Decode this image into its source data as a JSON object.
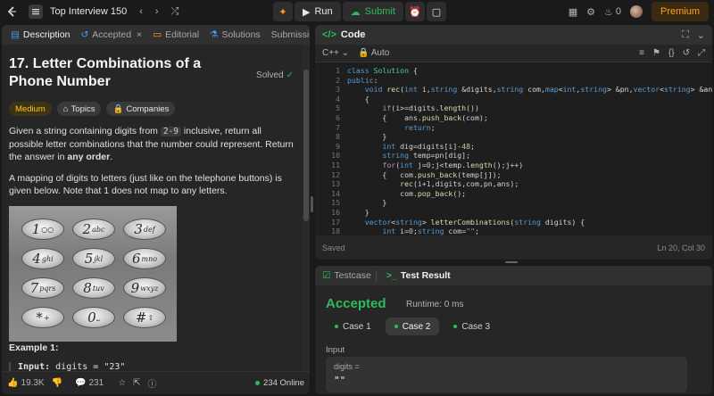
{
  "topbar": {
    "title": "Top Interview 150",
    "run_label": "Run",
    "submit_label": "Submit",
    "streak": "0",
    "premium_label": "Premium"
  },
  "left_tabs": [
    {
      "label": "Description"
    },
    {
      "label": "Accepted"
    },
    {
      "label": "Editorial"
    },
    {
      "label": "Solutions"
    },
    {
      "label": "Submissio"
    }
  ],
  "problem": {
    "title": "17. Letter Combinations of a Phone Number",
    "status": "Solved",
    "difficulty": "Medium",
    "topics_label": "Topics",
    "companies_label": "Companies",
    "desc_p1_a": "Given a string containing digits from ",
    "desc_p1_code": "2-9",
    "desc_p1_b": " inclusive, return all possible letter combinations that the number could represent. Return the answer in ",
    "desc_p1_bold": "any order",
    "desc_p1_end": ".",
    "desc_p2": "A mapping of digits to letters (just like on the telephone buttons) is given below. Note that 1 does not map to any letters.",
    "example_title": "Example 1:",
    "example_input_label": "Input:",
    "example_input_value": "digits = \"23\""
  },
  "phone_keys": [
    {
      "digit": "1",
      "letters": "○○"
    },
    {
      "digit": "2",
      "letters": "abc"
    },
    {
      "digit": "3",
      "letters": "def"
    },
    {
      "digit": "4",
      "letters": "ghi"
    },
    {
      "digit": "5",
      "letters": "jkl"
    },
    {
      "digit": "6",
      "letters": "mno"
    },
    {
      "digit": "7",
      "letters": "pqrs"
    },
    {
      "digit": "8",
      "letters": "tuv"
    },
    {
      "digit": "9",
      "letters": "wxyz"
    },
    {
      "digit": "*",
      "letters": "+"
    },
    {
      "digit": "0",
      "letters": "⎵"
    },
    {
      "digit": "#",
      "letters": "⇧"
    }
  ],
  "footer": {
    "likes": "19.3K",
    "comments": "231",
    "online": "234 Online"
  },
  "code_panel": {
    "title": "Code",
    "language": "C++",
    "mode": "Auto",
    "status": "Saved",
    "cursor": "Ln 20, Col 30"
  },
  "code_lines": [
    "class Solution {",
    "public:",
    "    void rec(int i,string &digits,string com,map<int,string> &pn,vector<string> &ans)",
    "    {",
    "        if(i>=digits.length())",
    "        {    ans.push_back(com);",
    "             return;",
    "        }",
    "        int dig=digits[i]-48;",
    "        string temp=pn[dig];",
    "        for(int j=0;j<temp.length();j++)",
    "        {   com.push_back(temp[j]);",
    "            rec(i+1,digits,com,pn,ans);",
    "            com.pop_back();",
    "        }",
    "    }",
    "    vector<string> letterCombinations(string digits) {",
    "        int i=0;string com=\"\";"
  ],
  "result": {
    "testcase_tab": "Testcase",
    "result_tab": "Test Result",
    "verdict": "Accepted",
    "runtime": "Runtime: 0 ms",
    "cases": [
      {
        "label": "Case 1"
      },
      {
        "label": "Case 2"
      },
      {
        "label": "Case 3"
      }
    ],
    "input_label": "Input",
    "var_name": "digits =",
    "var_value": "\"\""
  },
  "colors": {
    "accent_green": "#2cbb5d",
    "premium": "#ffa116",
    "medium": "#ffc01e"
  }
}
